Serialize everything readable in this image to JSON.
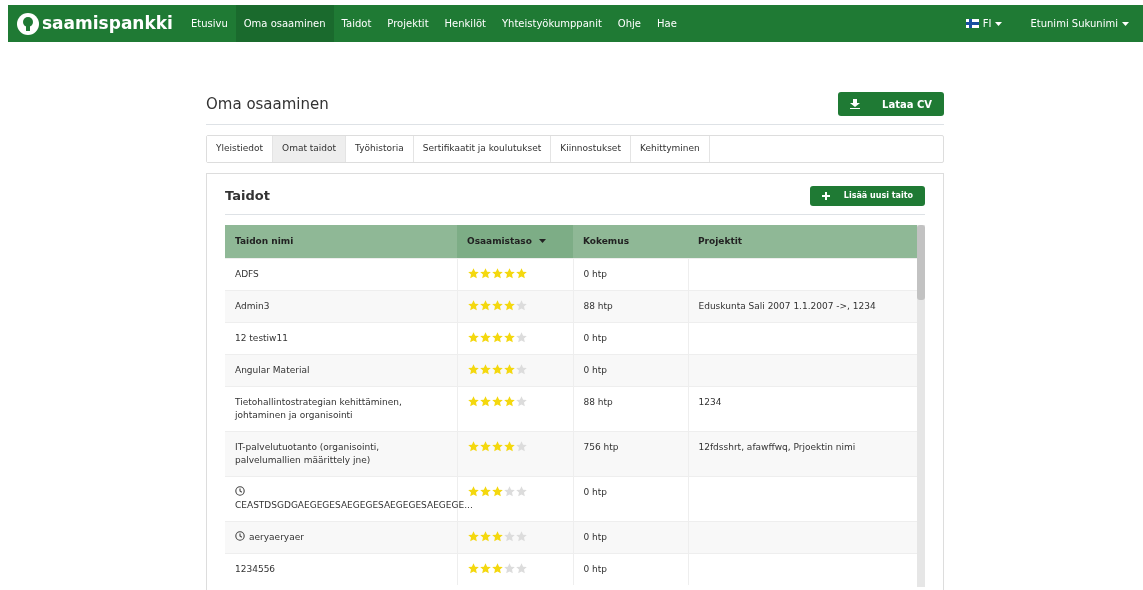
{
  "navbar": {
    "brand": "saamispankki",
    "items": [
      {
        "label": "Etusivu",
        "selected": false
      },
      {
        "label": "Oma osaaminen",
        "selected": true
      },
      {
        "label": "Taidot",
        "selected": false
      },
      {
        "label": "Projektit",
        "selected": false
      },
      {
        "label": "Henkilöt",
        "selected": false
      },
      {
        "label": "Yhteistyökumppanit",
        "selected": false
      },
      {
        "label": "Ohje",
        "selected": false
      },
      {
        "label": "Hae",
        "selected": false
      }
    ],
    "language": "FI",
    "user": "Etunimi Sukunimi"
  },
  "page": {
    "title": "Oma osaaminen",
    "download_button": "Lataa CV"
  },
  "tabs": [
    {
      "label": "Yleistiedot",
      "selected": false
    },
    {
      "label": "Omat taidot",
      "selected": true
    },
    {
      "label": "Työhistoria",
      "selected": false
    },
    {
      "label": "Sertifikaatit ja koulutukset",
      "selected": false
    },
    {
      "label": "Kiinnostukset",
      "selected": false
    },
    {
      "label": "Kehittyminen",
      "selected": false
    }
  ],
  "skills": {
    "title": "Taidot",
    "add_button": "Lisää uusi taito",
    "table": {
      "columns": [
        {
          "label": "Taidon nimi",
          "sorted": false
        },
        {
          "label": "Osaamistaso",
          "sorted": true
        },
        {
          "label": "Kokemus",
          "sorted": false
        },
        {
          "label": "Projektit",
          "sorted": false
        }
      ],
      "rows": [
        {
          "name": "ADFS",
          "pending": false,
          "stars": 5,
          "experience": "0 htp",
          "projects": ""
        },
        {
          "name": "Admin3",
          "pending": false,
          "stars": 4,
          "experience": "88 htp",
          "projects": "Eduskunta Sali 2007 1.1.2007 ->, 1234"
        },
        {
          "name": "12 testiw11",
          "pending": false,
          "stars": 4,
          "experience": "0 htp",
          "projects": ""
        },
        {
          "name": "Angular Material",
          "pending": false,
          "stars": 4,
          "experience": "0 htp",
          "projects": ""
        },
        {
          "name": "Tietohallintostrategian kehittäminen, johtaminen ja organisointi",
          "pending": false,
          "stars": 4,
          "experience": "88 htp",
          "projects": "1234"
        },
        {
          "name": "IT-palvelutuotanto (organisointi, palvelumallien määrittely jne)",
          "pending": false,
          "stars": 4,
          "experience": "756 htp",
          "projects": "12fdsshrt, afawffwq, Prjoektin nimi"
        },
        {
          "name": "CEASTDSGDGAEGEGESAEGEGESAEGEGESAEGEGE...",
          "pending": true,
          "stars": 3,
          "experience": "0 htp",
          "projects": ""
        },
        {
          "name": "aeryaeryaer",
          "pending": true,
          "stars": 3,
          "experience": "0 htp",
          "projects": ""
        },
        {
          "name": "1234556",
          "pending": false,
          "stars": 3,
          "experience": "0 htp",
          "projects": ""
        }
      ]
    }
  }
}
